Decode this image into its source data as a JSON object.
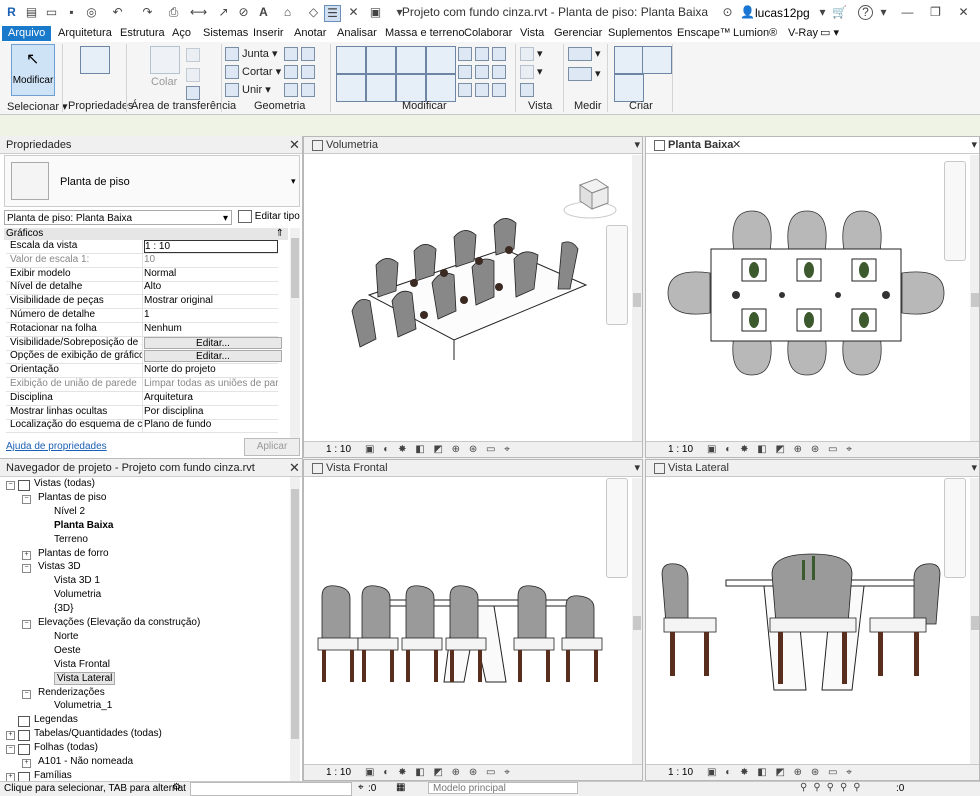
{
  "titlebar": {
    "title": "Projeto com fundo cinza.rvt - Planta de piso: Planta Baixa",
    "user": "lucas12pg",
    "help": "?"
  },
  "ribbon_tabs": [
    "Arquivo",
    "Arquitetura",
    "Estrutura",
    "Aço",
    "Sistemas",
    "Inserir",
    "Anotar",
    "Analisar",
    "Massa e terreno",
    "Colaborar",
    "Vista",
    "Gerenciar",
    "Suplementos",
    "Enscape™",
    "Lumion®",
    "V-Ray"
  ],
  "ribbon": {
    "modify_label": "Modificar",
    "select_label": "Selecionar ▾",
    "properties_label": "Propriedades",
    "paste_label": "Colar",
    "clipboard_label": "Área de transferência",
    "join_label": "Junta",
    "cut_label": "Cortar",
    "unite_label": "Unir",
    "geometry_label": "Geometria",
    "modify_group_label": "Modificar",
    "view_label": "Vista",
    "measure_label": "Medir",
    "create_label": "Criar"
  },
  "properties": {
    "title": "Propriedades",
    "type_name": "Planta de piso",
    "instance_selector": "Planta de piso: Planta Baixa",
    "edit_type": "Editar tipo",
    "section": "Gráficos",
    "rows": [
      {
        "k": "Escala da vista",
        "v": "1 : 10"
      },
      {
        "k": "Valor de escala    1:",
        "v": "10",
        "grey": true
      },
      {
        "k": "Exibir modelo",
        "v": "Normal"
      },
      {
        "k": "Nível de detalhe",
        "v": "Alto"
      },
      {
        "k": "Visibilidade de peças",
        "v": "Mostrar original"
      },
      {
        "k": "Número de detalhe",
        "v": "1"
      },
      {
        "k": "Rotacionar na folha",
        "v": "Nenhum"
      },
      {
        "k": "Visibilidade/Sobreposição de ...",
        "v": "Editar...",
        "button": true
      },
      {
        "k": "Opções de exibição de gráficos",
        "v": "Editar...",
        "button": true
      },
      {
        "k": "Orientação",
        "v": "Norte do projeto"
      },
      {
        "k": "Exibição de união de parede",
        "v": "Limpar todas as uniões de pare...",
        "grey": true
      },
      {
        "k": "Disciplina",
        "v": "Arquitetura"
      },
      {
        "k": "Mostrar linhas ocultas",
        "v": "Por disciplina"
      },
      {
        "k": "Localização do esquema de cor",
        "v": "Plano de fundo"
      }
    ],
    "help_link": "Ajuda de propriedades",
    "apply": "Aplicar"
  },
  "browser": {
    "title": "Navegador de projeto - Projeto com fundo cinza.rvt",
    "nodes": [
      {
        "label": "Vistas (todas)",
        "level": 0,
        "box": "−"
      },
      {
        "label": "Plantas de piso",
        "level": 1,
        "box": "−"
      },
      {
        "label": "Nível 2",
        "level": 2
      },
      {
        "label": "Planta Baixa",
        "level": 2,
        "bold": true
      },
      {
        "label": "Terreno",
        "level": 2
      },
      {
        "label": "Plantas de forro",
        "level": 1,
        "box": "+"
      },
      {
        "label": "Vistas 3D",
        "level": 1,
        "box": "−"
      },
      {
        "label": "Vista 3D 1",
        "level": 2
      },
      {
        "label": "Volumetria",
        "level": 2
      },
      {
        "label": "{3D}",
        "level": 2
      },
      {
        "label": "Elevações (Elevação da construção)",
        "level": 1,
        "box": "−"
      },
      {
        "label": "Norte",
        "level": 2
      },
      {
        "label": "Oeste",
        "level": 2
      },
      {
        "label": "Vista Frontal",
        "level": 2
      },
      {
        "label": "Vista Lateral",
        "level": 2,
        "selected": true
      },
      {
        "label": "Renderizações",
        "level": 1,
        "box": "−"
      },
      {
        "label": "Volumetria_1",
        "level": 2
      },
      {
        "label": "Legendas",
        "level": 0
      },
      {
        "label": "Tabelas/Quantidades (todas)",
        "level": 0,
        "box": "+"
      },
      {
        "label": "Folhas (todas)",
        "level": 0,
        "box": "−"
      },
      {
        "label": "A101 - Não nomeada",
        "level": 1,
        "box": "+"
      },
      {
        "label": "Famílias",
        "level": 0,
        "box": "+"
      }
    ]
  },
  "views": {
    "v1": {
      "title": "Volumetria",
      "scale": "1 : 10"
    },
    "v2": {
      "title": "Planta Baixa",
      "scale": "1 : 10"
    },
    "v3": {
      "title": "Vista Frontal",
      "scale": "1 : 10"
    },
    "v4": {
      "title": "Vista Lateral",
      "scale": "1 : 10"
    }
  },
  "status": {
    "hint": "Clique para selecionar, TAB para alternat",
    "zero": ":0",
    "model": "Modelo principal"
  },
  "colors": {
    "accent": "#1979ca",
    "ribbon_bg": "#f5f5f5",
    "chair": "#9e9e9e",
    "leg": "#5a2e1e"
  }
}
